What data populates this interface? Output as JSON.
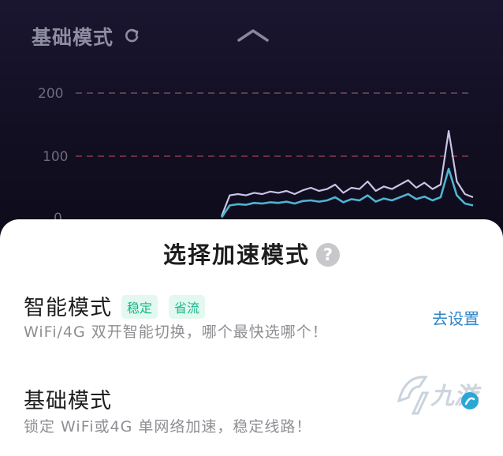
{
  "header": {
    "mode_title": "基础模式",
    "refresh_icon": "refresh-icon",
    "collapse_icon": "chevron-up-icon"
  },
  "chart_data": {
    "type": "line",
    "tick_labels": [
      "200",
      "100",
      "0"
    ],
    "ylim": [
      0,
      200
    ],
    "reference_lines": [
      200,
      100
    ],
    "reference_line_colors": [
      "#7a4a58",
      "#8a3a4a"
    ],
    "series_colors": [
      "#c9c4e6",
      "#4fb3d2"
    ],
    "series": [
      {
        "values": [
          null,
          null,
          null,
          null,
          null,
          null,
          null,
          null,
          null,
          null,
          null,
          null,
          null,
          null,
          null,
          null,
          null,
          null,
          5,
          38,
          40,
          38,
          42,
          40,
          44,
          42,
          45,
          40,
          46,
          50,
          45,
          48,
          55,
          42,
          50,
          48,
          60,
          45,
          52,
          48,
          55,
          62,
          50,
          58,
          48,
          55,
          140,
          60,
          40,
          35
        ]
      },
      {
        "values": [
          null,
          null,
          null,
          null,
          null,
          null,
          null,
          null,
          null,
          null,
          null,
          null,
          null,
          null,
          null,
          null,
          null,
          null,
          3,
          22,
          24,
          23,
          26,
          25,
          27,
          26,
          28,
          25,
          29,
          30,
          28,
          30,
          35,
          27,
          32,
          30,
          38,
          28,
          33,
          30,
          35,
          40,
          32,
          36,
          30,
          35,
          80,
          38,
          25,
          22
        ]
      }
    ]
  },
  "sheet": {
    "title": "选择加速模式",
    "help_icon_glyph": "?",
    "smart_mode": {
      "name": "智能模式",
      "tags": [
        "稳定",
        "省流"
      ],
      "desc": "WiFi/4G 双开智能切换，哪个最快选哪个！",
      "action": "去设置"
    },
    "basic_mode": {
      "name": "基础模式",
      "desc": "锁定 WiFi或4G 单网络加速，稳定线路！"
    }
  },
  "watermark": {
    "text": "九游",
    "icon": "jiuyou-logo-icon"
  }
}
